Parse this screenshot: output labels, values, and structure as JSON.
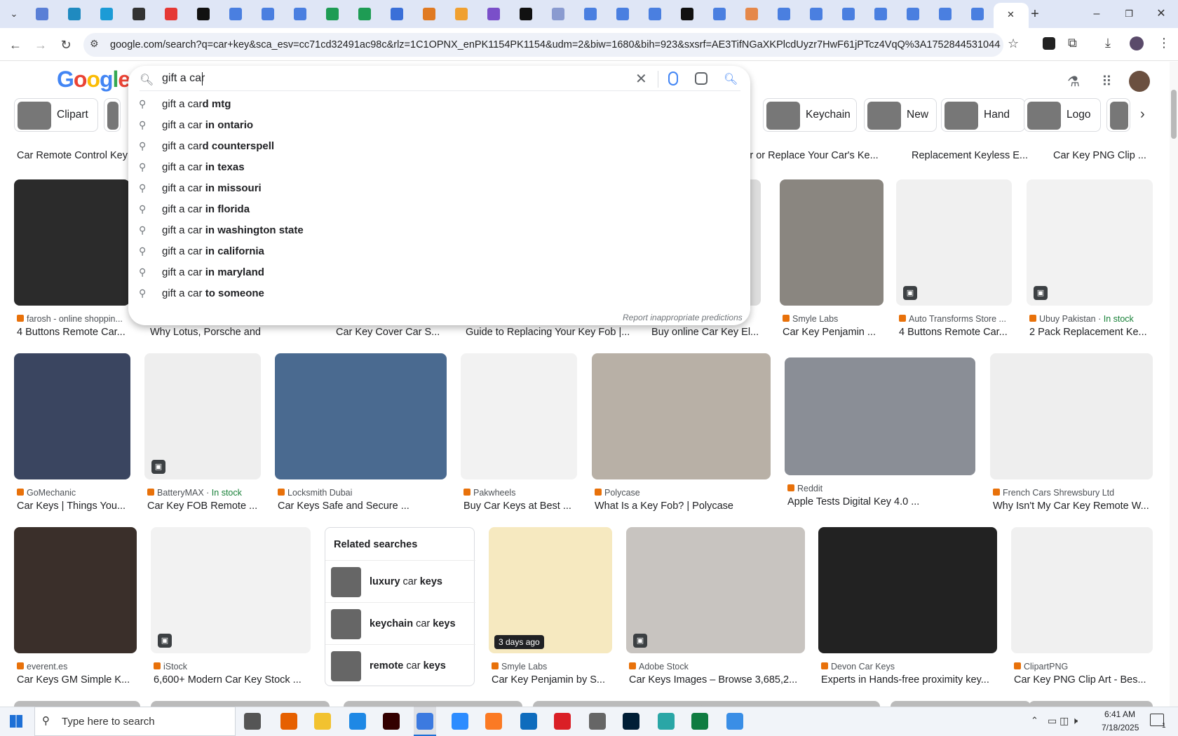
{
  "browser": {
    "url": "google.com/search?q=car+key&sca_esv=cc71cd32491ac98c&rlz=1C1OPNX_enPK1154PK1154&udm=2&biw=1680&bih=923&sxsrf=AE3TifNGaXKPlcdUyzr7HwF61jPTcz4VqQ%3A1752844531044&ei=80h...",
    "new_tab": "+",
    "minimize": "–",
    "restore": "❐",
    "close": "✕"
  },
  "google": {
    "logo": "Google",
    "query": "gift a car",
    "report": "Report inappropriate predictions",
    "suggestions": [
      {
        "prefix": "gift a car",
        "suffix": "d mtg"
      },
      {
        "prefix": "gift a car",
        "suffix": " in ontario"
      },
      {
        "prefix": "gift a car",
        "suffix": "d counterspell"
      },
      {
        "prefix": "gift a car",
        "suffix": " in texas"
      },
      {
        "prefix": "gift a car",
        "suffix": " in missouri"
      },
      {
        "prefix": "gift a car",
        "suffix": " in florida"
      },
      {
        "prefix": "gift a car",
        "suffix": " in washington state"
      },
      {
        "prefix": "gift a car",
        "suffix": " in california"
      },
      {
        "prefix": "gift a car",
        "suffix": " in maryland"
      },
      {
        "prefix": "gift a car",
        "suffix": " to someone"
      }
    ]
  },
  "chips": [
    {
      "label": "Clipart"
    },
    {
      "label": "Keychain"
    },
    {
      "label": "New"
    },
    {
      "label": "Hand"
    },
    {
      "label": "Logo"
    }
  ],
  "row0": [
    {
      "title": "Car Remote Control Key ..."
    },
    {
      "title": "pair or Replace Your Car's Ke..."
    },
    {
      "title": "Replacement Keyless E..."
    },
    {
      "title": "Car Key PNG Clip ..."
    }
  ],
  "row1": [
    {
      "source": "farosh - online shoppin...",
      "title": "4 Buttons Remote Car..."
    },
    {
      "source": "",
      "title": "Why Lotus, Porsche and Tesla Ca..."
    },
    {
      "source": "",
      "title": "Car Key Cover Car S..."
    },
    {
      "source": "",
      "title": "Guide to Replacing Your Key Fob |..."
    },
    {
      "source": "",
      "title": "Buy online Car Key El..."
    },
    {
      "source": "Smyle Labs",
      "title": "Car Key Penjamin ..."
    },
    {
      "source": "Auto Transforms Store ...",
      "title": "4 Buttons Remote Car..."
    },
    {
      "source": "Ubuy Pakistan",
      "stock": "In stock",
      "title": "2 Pack Replacement Ke..."
    }
  ],
  "row2": [
    {
      "source": "GoMechanic",
      "title": "Car Keys | Things You..."
    },
    {
      "source": "BatteryMAX",
      "stock": "In stock",
      "title": "Car Key FOB Remote ..."
    },
    {
      "source": "Locksmith Dubai",
      "title": "Car Keys Safe and Secure ..."
    },
    {
      "source": "Pakwheels",
      "title": "Buy Car Keys at Best ..."
    },
    {
      "source": "Polycase",
      "title": "What Is a Key Fob? | Polycase"
    },
    {
      "source": "Reddit",
      "title": "Apple Tests Digital Key 4.0 ..."
    },
    {
      "source": "French Cars Shrewsbury Ltd",
      "title": "Why Isn't My Car Key Remote W..."
    }
  ],
  "row3": [
    {
      "source": "everent.es",
      "title": "Car Keys GM Simple K..."
    },
    {
      "source": "iStock",
      "title": "6,600+ Modern Car Key Stock ..."
    },
    {
      "source": "Smyle Labs",
      "title": "Car Key Penjamin by S...",
      "ago": "3 days ago"
    },
    {
      "source": "Adobe Stock",
      "title": "Car Keys Images – Browse 3,685,2..."
    },
    {
      "source": "Devon Car Keys",
      "title": "Experts in Hands-free proximity key..."
    },
    {
      "source": "ClipartPNG",
      "title": "Car Key PNG Clip Art - Bes..."
    }
  ],
  "related": {
    "heading": "Related searches",
    "items": [
      {
        "bold1": "luxury",
        "plain": " car ",
        "bold2": "keys"
      },
      {
        "bold1": "keychain",
        "plain": " car ",
        "bold2": "keys"
      },
      {
        "bold1": "remote",
        "plain": " car ",
        "bold2": "keys"
      }
    ]
  },
  "taskbar": {
    "search_placeholder": "Type here to search",
    "time": "6:41 AM",
    "date": "7/18/2025",
    "notification_count": "1"
  }
}
